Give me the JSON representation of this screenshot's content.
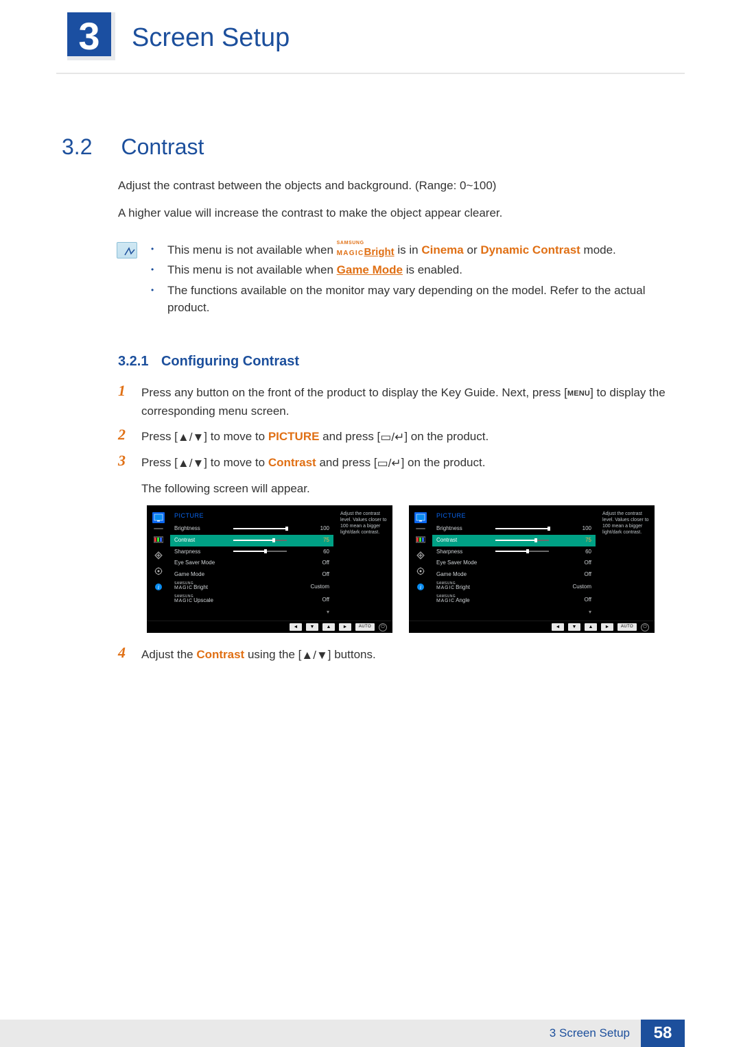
{
  "chapter": {
    "number": "3",
    "title": "Screen Setup"
  },
  "section": {
    "number": "3.2",
    "title": "Contrast"
  },
  "intro": {
    "p1": "Adjust the contrast between the objects and background. (Range: 0~100)",
    "p2": "A higher value will increase the contrast to make the object appear clearer."
  },
  "notes": {
    "n1_a": "This menu is not available when ",
    "n1_magic_top": "SAMSUNG",
    "n1_magic_mid": "MAGIC",
    "n1_magic_right": "Bright",
    "n1_b": " is in ",
    "n1_c": "Cinema",
    "n1_d": " or ",
    "n1_e": "Dynamic Contrast",
    "n1_f": " mode.",
    "n2_a": "This menu is not available when ",
    "n2_b": "Game Mode",
    "n2_c": " is enabled.",
    "n3": "The functions available on the monitor may vary depending on the model. Refer to the actual product."
  },
  "subsection": {
    "number": "3.2.1",
    "title": "Configuring Contrast"
  },
  "steps": {
    "s1_a": "Press any button on the front of the product to display the Key Guide. Next, press [",
    "s1_menu": "MENU",
    "s1_b": "] to display the corresponding menu screen.",
    "s2_a": "Press [",
    "s2_ud": "▲/▼",
    "s2_b": "] to move to ",
    "s2_pic": "PICTURE",
    "s2_c": " and press [",
    "s2_enter": "▭/↵",
    "s2_d": "] on the product.",
    "s3_a": "Press [",
    "s3_ud": "▲/▼",
    "s3_b": "] to move to ",
    "s3_contrast": "Contrast",
    "s3_c": " and press [",
    "s3_enter": "▭/↵",
    "s3_d": "] on the product.",
    "s3_tail": "The following screen will appear.",
    "s4_a": "Adjust the ",
    "s4_contrast": "Contrast",
    "s4_b": " using the [",
    "s4_ud": "▲/▼",
    "s4_c": "] buttons."
  },
  "osd": {
    "title": "PICTURE",
    "help": "Adjust the contrast level. Values closer to 100 mean a bigger light/dark contrast.",
    "footer_auto": "AUTO",
    "left": {
      "rows": [
        {
          "label": "Brightness",
          "value": "100",
          "slider": 100,
          "selected": false
        },
        {
          "label": "Contrast",
          "value": "75",
          "slider": 75,
          "selected": true
        },
        {
          "label": "Sharpness",
          "value": "60",
          "slider": 60,
          "selected": false
        },
        {
          "label": "Eye Saver Mode",
          "value": "Off",
          "selected": false
        },
        {
          "label": "Game Mode",
          "value": "Off",
          "selected": false
        },
        {
          "label_magic_top": "SAMSUNG",
          "label_magic_mid": "MAGIC",
          "label_magic_suffix": "Bright",
          "value": "Custom",
          "selected": false
        },
        {
          "label_magic_top": "SAMSUNG",
          "label_magic_mid": "MAGIC",
          "label_magic_suffix": "Upscale",
          "value": "Off",
          "selected": false
        }
      ]
    },
    "right": {
      "rows": [
        {
          "label": "Brightness",
          "value": "100",
          "slider": 100,
          "selected": false
        },
        {
          "label": "Contrast",
          "value": "75",
          "slider": 75,
          "selected": true
        },
        {
          "label": "Sharpness",
          "value": "60",
          "slider": 60,
          "selected": false
        },
        {
          "label": "Eye Saver Mode",
          "value": "Off",
          "selected": false
        },
        {
          "label": "Game Mode",
          "value": "Off",
          "selected": false
        },
        {
          "label_magic_top": "SAMSUNG",
          "label_magic_mid": "MAGIC",
          "label_magic_suffix": "Bright",
          "value": "Custom",
          "selected": false
        },
        {
          "label_magic_top": "SAMSUNG",
          "label_magic_mid": "MAGIC",
          "label_magic_suffix": "Angle",
          "value": "Off",
          "selected": false
        }
      ]
    }
  },
  "footer": {
    "label": "3 Screen Setup",
    "page": "58"
  }
}
